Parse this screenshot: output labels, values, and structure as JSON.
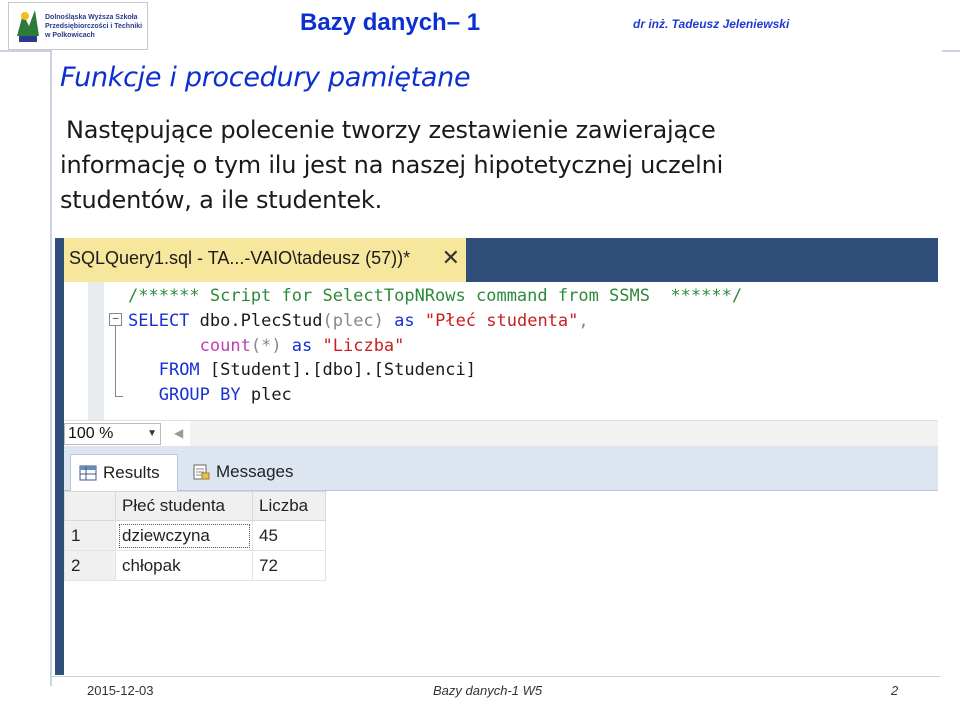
{
  "header": {
    "logo_lines": [
      "Dolnośląska Wyższa Szkoła",
      "Przedsiębiorczości i Techniki",
      "w Polkowicach"
    ],
    "course_title": "Bazy danych– 1",
    "author": "dr inż. Tadeusz Jeleniewski"
  },
  "slide": {
    "title": "Funkcje i procedury pamiętane",
    "body_lines": [
      "Następujące polecenie tworzy zestawienie zawierające",
      "informację o tym ilu jest na naszej hipotetycznej uczelni",
      "studentów, a ile studentek."
    ]
  },
  "ssms": {
    "tab_label": "SQLQuery1.sql - TA...-VAIO\\tadeusz (57))*",
    "tab_close": "✕",
    "code": {
      "comment": "/****** Script for SelectTopNRows command from SSMS  ******/",
      "select_kw": "SELECT",
      "select_rest_1": " dbo.PlecStud",
      "select_paren": "(plec)",
      "as1": " as ",
      "alias1": "\"Płeć studenta\"",
      "comma": ",",
      "count_fn": "count",
      "count_arg": "(*)",
      "as2": " as ",
      "alias2": "\"Liczba\"",
      "from_kw": "FROM",
      "from_rest": " [Student].[dbo].[Studenci]",
      "group_kw": "GROUP BY",
      "group_rest": " plec",
      "collapse_symbol": "−"
    },
    "zoom": "100 %",
    "result_tabs": {
      "results": "Results",
      "messages": "Messages"
    },
    "grid": {
      "headers": [
        "Płeć studenta",
        "Liczba"
      ],
      "rows": [
        {
          "num": "1",
          "plec": "dziewczyna",
          "liczba": "45"
        },
        {
          "num": "2",
          "plec": "chłopak",
          "liczba": "72"
        }
      ]
    }
  },
  "footer": {
    "date": "2015-12-03",
    "center": "Bazy danych-1 W5",
    "page": "2"
  }
}
